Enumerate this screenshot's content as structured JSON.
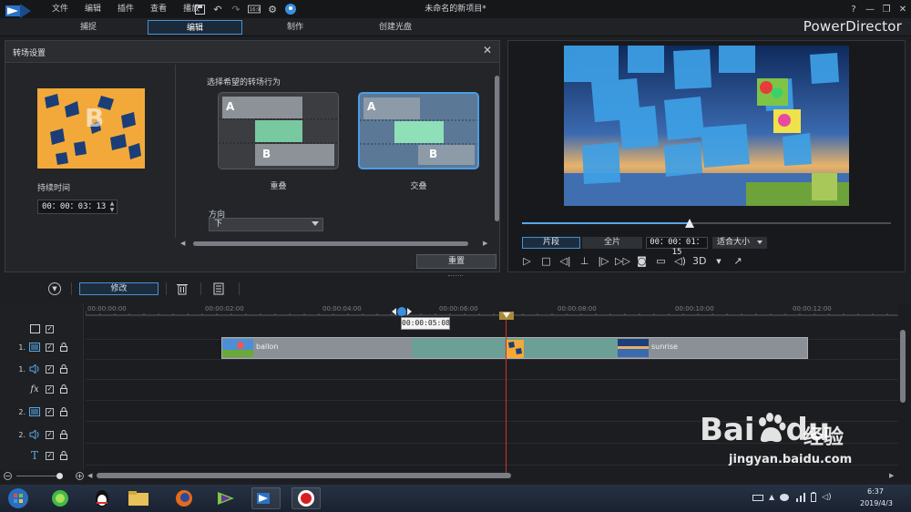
{
  "menu": {
    "items": [
      "文件",
      "编辑",
      "插件",
      "查看",
      "播放"
    ],
    "window_title": "未命名的新项目*"
  },
  "window_controls": [
    "?",
    "—",
    "❐",
    "✕"
  ],
  "modes": {
    "capture": "捕捉",
    "edit": "编辑",
    "produce": "制作",
    "disc": "创建光盘",
    "active": "编辑"
  },
  "brand": "PowerDirector",
  "transition_panel": {
    "title": "转场设置",
    "duration_label": "持续时间",
    "duration_value": "00：00：03：13",
    "behavior_label": "选择希望的转场行为",
    "option_overlap": {
      "label": "重叠",
      "a": "A",
      "b": "B"
    },
    "option_cross": {
      "label": "交叠",
      "a": "A",
      "b": "B",
      "selected": true
    },
    "direction_label": "方向",
    "direction_value": "下",
    "reset_label": "重置"
  },
  "viewer": {
    "seg_clip": "片段",
    "seg_movie": "全片",
    "timecode": "00：00：01：15",
    "fit_label": "适合大小",
    "label_3d": "3D",
    "scrub_progress": 0.455
  },
  "toolbar": {
    "modify_label": "修改"
  },
  "timeline": {
    "ruler_ticks": [
      "00:00:00:00",
      "00:00:02:00",
      "00:00:04:00",
      "00:00:06:00",
      "00:00:08:00",
      "00:00:10:00",
      "00:00:12:00"
    ],
    "tooltip": "00:00:05:08",
    "tracks": [
      {
        "num": "",
        "icon": "chapter"
      },
      {
        "num": "1.",
        "icon": "video"
      },
      {
        "num": "1.",
        "icon": "audio"
      },
      {
        "num": "",
        "icon": "fx",
        "label": "fx"
      },
      {
        "num": "2.",
        "icon": "video"
      },
      {
        "num": "2.",
        "icon": "audio"
      },
      {
        "num": "",
        "icon": "title",
        "label": "T"
      }
    ],
    "clip_first": "ballon",
    "clip_second": "sunrise"
  },
  "taskbar": {
    "time": "6:37",
    "date": "2019/4/3"
  },
  "watermark": {
    "logo": "Bai",
    "logo_tail": "du",
    "cn": "经验",
    "url": "jingyan.baidu.com"
  },
  "colors": {
    "accent": "#4a90d0",
    "playhead": "#d03030",
    "transition_clip": "#6c9f95"
  }
}
